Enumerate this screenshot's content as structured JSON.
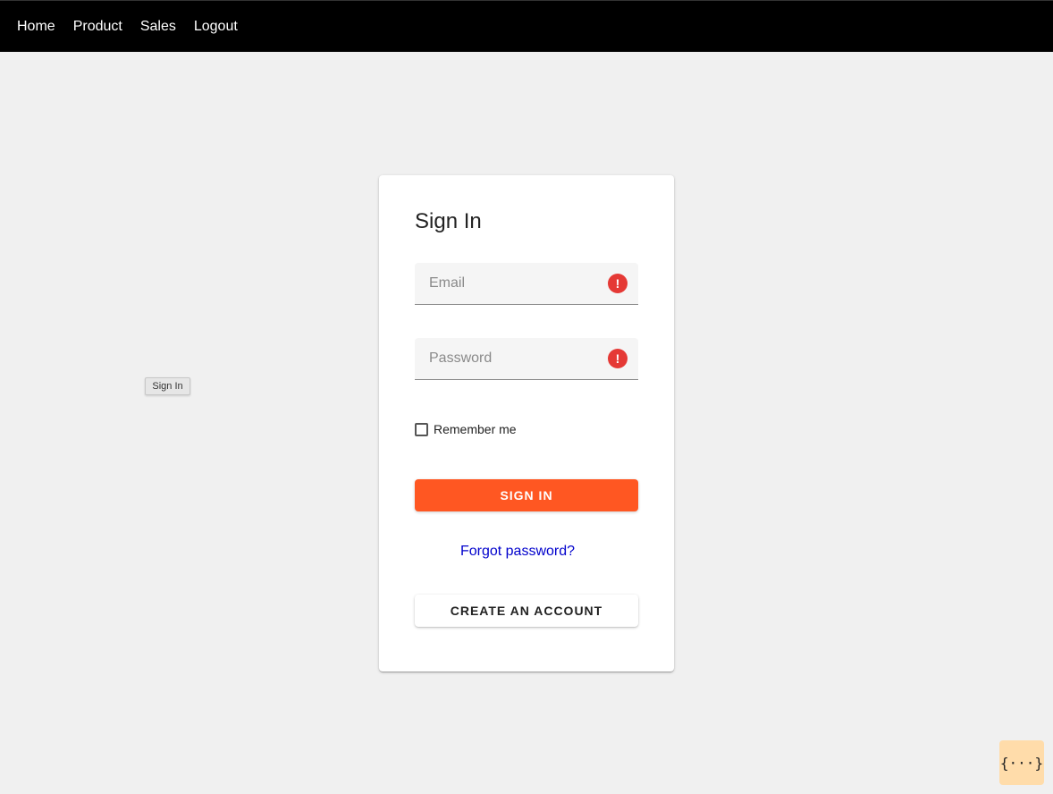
{
  "nav": {
    "items": [
      {
        "label": "Home"
      },
      {
        "label": "Product"
      },
      {
        "label": "Sales"
      },
      {
        "label": "Logout"
      }
    ]
  },
  "form": {
    "title": "Sign In",
    "email": {
      "placeholder": "Email",
      "value": "",
      "error_icon": "exclamation-icon"
    },
    "password": {
      "placeholder": "Password",
      "value": "",
      "error_icon": "exclamation-icon"
    },
    "remember_label": "Remember me",
    "remember_checked": false,
    "signin_label": "SIGN IN",
    "forgot_label": "Forgot password?",
    "create_label": "CREATE AN ACCOUNT"
  },
  "floating_label": "Sign In",
  "devtools_label": "{···}",
  "colors": {
    "navbar": "#000000",
    "primary_button": "#ff5722",
    "error": "#e53935",
    "link": "#0000cc",
    "background": "#f0f0f0"
  }
}
